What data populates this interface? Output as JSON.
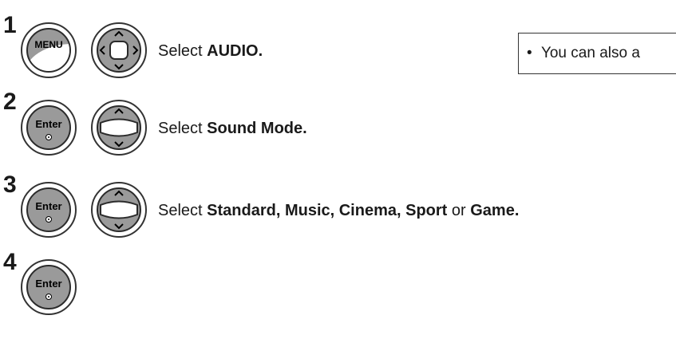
{
  "steps": [
    {
      "number": "1",
      "buttons": [
        "menu-button",
        "navigation-dpad"
      ],
      "menu_label": "MENU",
      "text_prefix": "Select ",
      "text_bold": "AUDIO."
    },
    {
      "number": "2",
      "buttons": [
        "enter-button",
        "up-down-button"
      ],
      "enter_label": "Enter",
      "text_prefix": "Select ",
      "text_bold": "Sound Mode."
    },
    {
      "number": "3",
      "buttons": [
        "enter-button",
        "up-down-button"
      ],
      "enter_label": "Enter",
      "text_prefix": "Select ",
      "text_bold_1": "Standard, Music, Cinema, Sport",
      "text_mid": " or ",
      "text_bold_2": "Game."
    },
    {
      "number": "4",
      "buttons": [
        "enter-button"
      ],
      "enter_label": "Enter"
    }
  ],
  "note": {
    "bullet": "•",
    "text": "You can also a"
  },
  "colors": {
    "button_fill": "#9a9a9a",
    "outline": "#2b2b2b",
    "text": "#1a1a1a"
  }
}
